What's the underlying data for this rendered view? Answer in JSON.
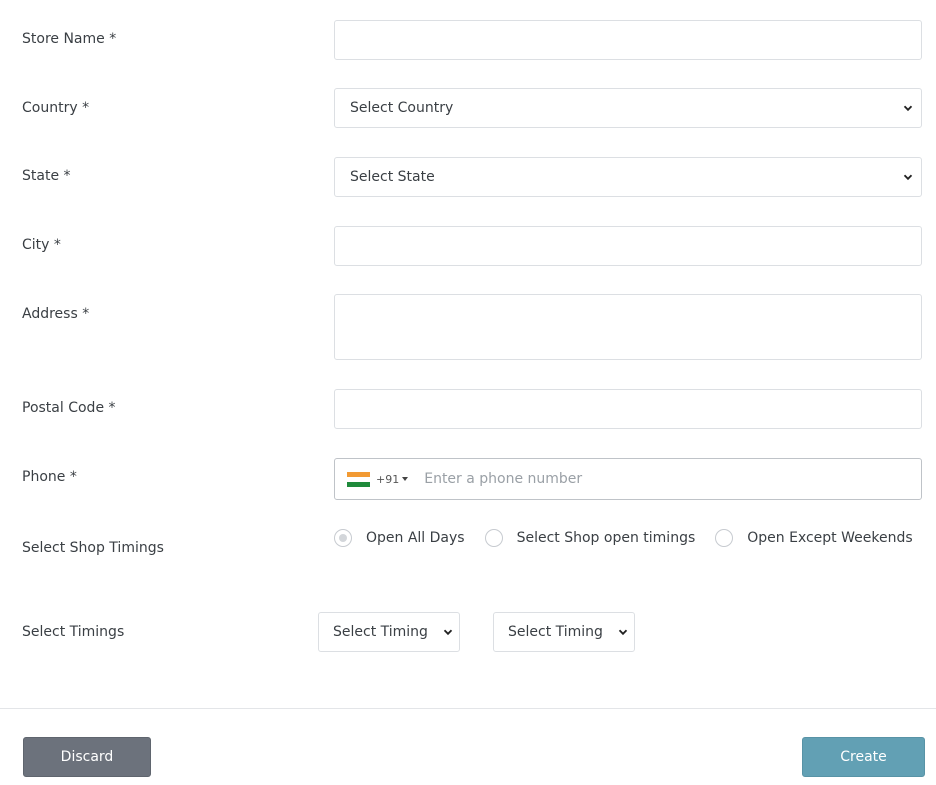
{
  "form": {
    "store_name": {
      "label": "Store Name *",
      "value": ""
    },
    "country": {
      "label": "Country *",
      "selected": "Select Country"
    },
    "state": {
      "label": "State *",
      "selected": "Select State"
    },
    "city": {
      "label": "City *",
      "value": ""
    },
    "address": {
      "label": "Address *",
      "value": ""
    },
    "postal_code": {
      "label": "Postal Code *",
      "value": ""
    },
    "phone": {
      "label": "Phone *",
      "dial_code": "+91",
      "country_flag": "india-flag-icon",
      "placeholder": "Enter a phone number",
      "value": ""
    },
    "shop_timings": {
      "label": "Select Shop Timings",
      "options": [
        {
          "label": "Open All Days",
          "selected": true
        },
        {
          "label": "Select Shop open timings",
          "selected": false
        },
        {
          "label": "Open Except Weekends",
          "selected": false
        }
      ]
    },
    "timings": {
      "label": "Select Timings",
      "from": "Select Timing",
      "to": "Select Timing"
    }
  },
  "footer": {
    "discard_label": "Discard",
    "create_label": "Create"
  },
  "colors": {
    "discard_button": "#6c727c",
    "create_button": "#62a0b4",
    "flag_saffron": "#f29a33",
    "flag_white": "#ffffff",
    "flag_green": "#1f8a3b"
  }
}
